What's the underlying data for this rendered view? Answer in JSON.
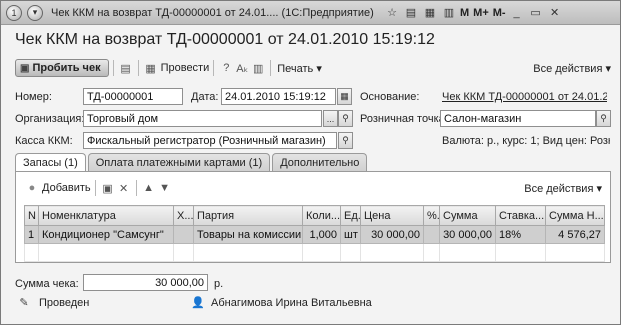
{
  "window": {
    "title": "Чек ККМ на возврат ТД-00000001 от 24.01....  (1С:Предприятие)",
    "m_labels": [
      "M",
      "M+",
      "M-"
    ]
  },
  "header": {
    "title": "Чек ККМ на возврат ТД-00000001 от 24.01.2010 15:19:12"
  },
  "toolbar": {
    "post_check_label": "Пробить чек",
    "post_label": "Провести",
    "print_label": "Печать ▾",
    "all_actions_label": "Все действия ▾"
  },
  "form": {
    "number_label": "Номер:",
    "number_value": "ТД-00000001",
    "date_label": "Дата:",
    "date_value": "24.01.2010 15:19:12",
    "basis_label": "Основание:",
    "basis_value": "Чек ККМ ТД-00000001 от 24.01.2...",
    "org_label": "Организация:",
    "org_value": "Торговый дом",
    "retail_point_label": "Розничная точка:",
    "retail_point_value": "Салон-магазин",
    "kkm_label": "Касса ККМ:",
    "kkm_value": "Фискальный регистратор (Розничный магазин)",
    "currency_info": "Валюта: р., курс: 1; Вид цен: Розн..."
  },
  "tabs": [
    {
      "label": "Запасы (1)"
    },
    {
      "label": "Оплата платежными картами (1)"
    },
    {
      "label": "Дополнительно"
    }
  ],
  "panel": {
    "add_label": "Добавить",
    "all_actions_label": "Все действия ▾"
  },
  "table": {
    "headers": [
      "N",
      "Номенклатура",
      "Х...",
      "Партия",
      "Коли...",
      "Ед.",
      "Цена",
      "%...",
      "Сумма",
      "Ставка...",
      "Сумма Н..."
    ],
    "rows": [
      [
        "1",
        "Кондиционер \"Самсунг\"",
        "",
        "Товары на комиссии",
        "1,000",
        "шт",
        "30 000,00",
        "",
        "30 000,00",
        "18%",
        "4 576,27"
      ]
    ]
  },
  "footer": {
    "sum_label": "Сумма чека:",
    "sum_value": "30 000,00",
    "sum_currency": "р.",
    "status": "Проведен",
    "author": "Абнагимова Ирина Витальевна"
  }
}
